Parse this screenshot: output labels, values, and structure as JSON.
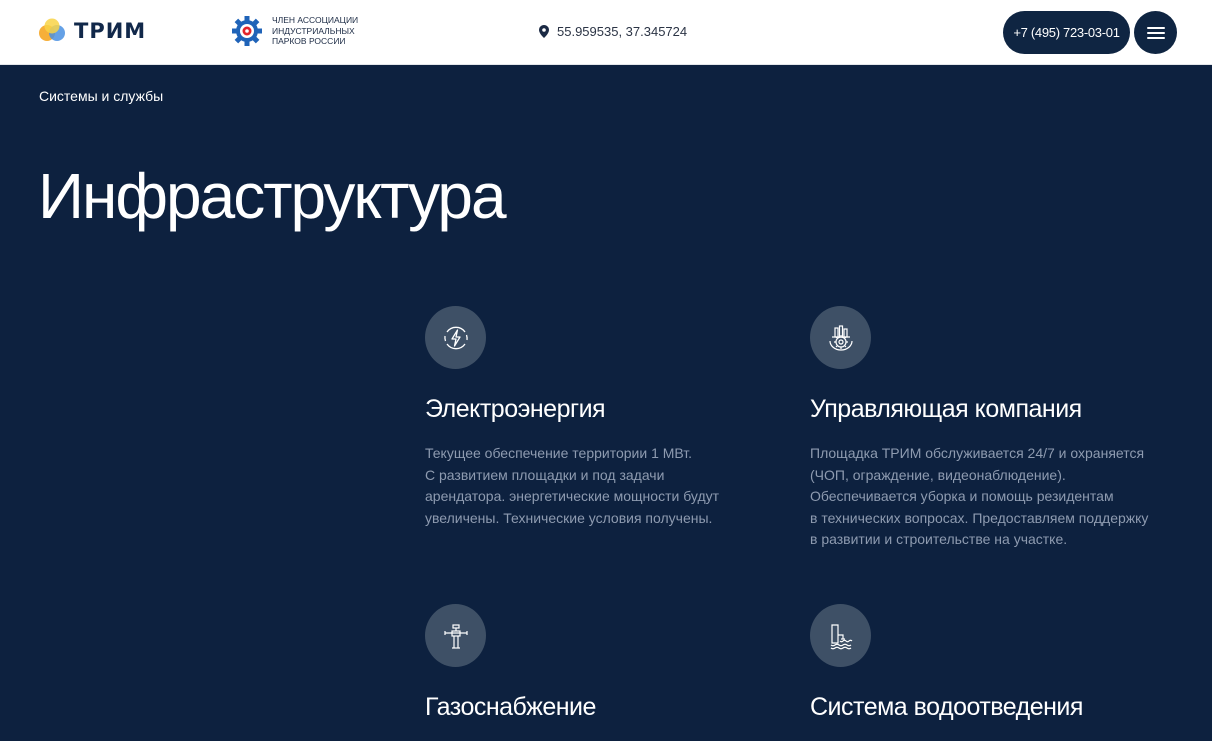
{
  "header": {
    "logo_text": "ТРИМ",
    "association_text": "ЧЛЕН АССОЦИАЦИИ\nИНДУСТРИАЛЬНЫХ\nПАРКОВ РОССИИ",
    "coordinates": "55.959535, 37.345724",
    "phone": "+7 (495) 723-03-01",
    "menu_icon": "hamburger-icon",
    "colors": {
      "logo_orange": "#f5a623",
      "logo_blue": "#4a90e2",
      "logo_yellow": "#f8d347",
      "dark": "#0f2542"
    }
  },
  "breadcrumb": "Системы и службы",
  "page_title": "Инфраструктура",
  "cards": [
    {
      "icon": "power-icon",
      "title": "Электроэнергия",
      "text": "Текущее обеспечение территории 1 МВт.\nС развитием площадки и под задачи\nарендатора. энергетические мощности будут\nувеличены. Технические условия получены."
    },
    {
      "icon": "industrial-management-icon",
      "title": "Управляющая компания",
      "text": "Площадка ТРИМ обслуживается 24/7 и охраняется\n(ЧОП, ограждение, видеонаблюдение).\nОбеспечивается уборка и помощь резидентам\nв технических вопросах. Предоставляем поддержку\nв развитии и строительстве на участке."
    },
    {
      "icon": "gas-pipe-icon",
      "title": "Газоснабжение",
      "text": ""
    },
    {
      "icon": "water-drainage-icon",
      "title": "Система водоотведения",
      "text": ""
    }
  ],
  "theme": {
    "background": "#0d213f",
    "icon_circle": "#3e5066",
    "muted_text": "#8e9bb0"
  }
}
